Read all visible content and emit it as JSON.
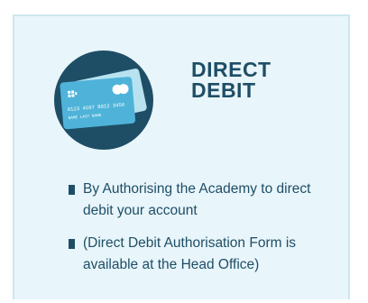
{
  "card": {
    "title_line1": "DIRECT",
    "title_line2": "DEBIT",
    "icon": "credit-card-icon",
    "card_number": "0123 4567 8912 3456",
    "card_name": "NAME LAST NAME",
    "items": [
      {
        "text": "By Authorising the Academy to direct debit your account"
      },
      {
        "text": "(Direct Debit Authorisation Form is available at the Head Office)"
      }
    ]
  },
  "colors": {
    "background": "#e8f5fa",
    "border": "#cde7ef",
    "text": "#1e4e66",
    "circle": "#1e4e66",
    "card_front": "#4fb3d9",
    "card_back": "#b9e2f1"
  }
}
